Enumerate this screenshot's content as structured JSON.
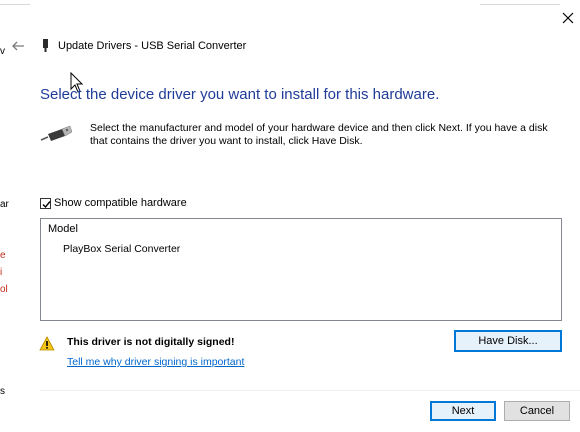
{
  "window": {
    "title": "Update Drivers - USB Serial Converter"
  },
  "background_fragments": [
    "v",
    "ar",
    "e",
    "i",
    "ol",
    "s"
  ],
  "main": {
    "heading": "Select the device driver you want to install for this hardware.",
    "description": "Select the manufacturer and model of your hardware device and then click Next. If you have a disk that contains the driver you want to install, click Have Disk."
  },
  "compatible": {
    "label": "Show compatible hardware",
    "checked": true
  },
  "model_list": {
    "header": "Model",
    "items": [
      "PlayBox Serial Converter"
    ]
  },
  "warning": {
    "text": "This driver is not digitally signed!",
    "link": "Tell me why driver signing is important"
  },
  "buttons": {
    "have_disk": "Have Disk...",
    "next": "Next",
    "cancel": "Cancel"
  },
  "colors": {
    "heading": "#1f3c98",
    "link": "#0066cc",
    "focus_border": "#0078d7",
    "warning": "#f5c518"
  }
}
